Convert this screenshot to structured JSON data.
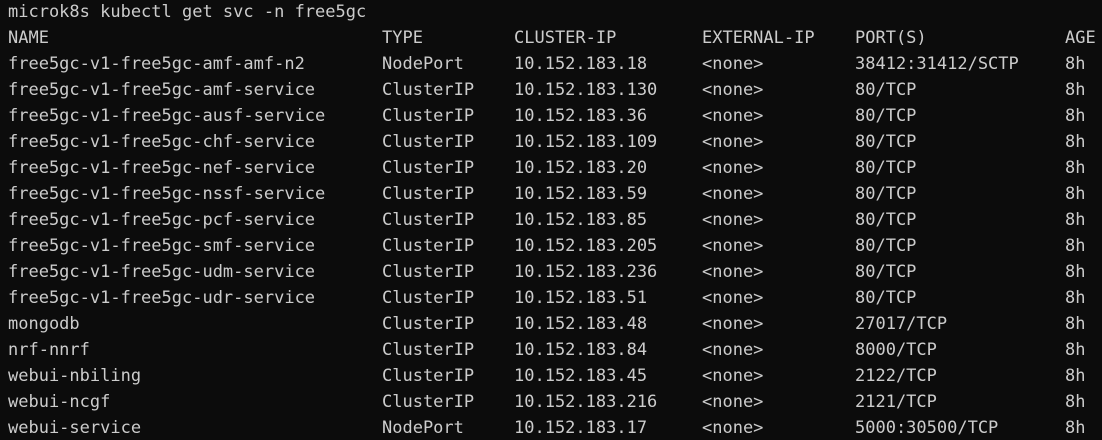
{
  "terminal": {
    "command": "microk8s kubectl get svc -n free5gc",
    "headers": {
      "name": "NAME",
      "type": "TYPE",
      "cluster_ip": "CLUSTER-IP",
      "external_ip": "EXTERNAL-IP",
      "ports": "PORT(S)",
      "age": "AGE"
    },
    "rows": [
      {
        "name": "free5gc-v1-free5gc-amf-amf-n2",
        "type": "NodePort",
        "cluster_ip": "10.152.183.18",
        "external_ip": "<none>",
        "ports": "38412:31412/SCTP",
        "age": "8h"
      },
      {
        "name": "free5gc-v1-free5gc-amf-service",
        "type": "ClusterIP",
        "cluster_ip": "10.152.183.130",
        "external_ip": "<none>",
        "ports": "80/TCP",
        "age": "8h"
      },
      {
        "name": "free5gc-v1-free5gc-ausf-service",
        "type": "ClusterIP",
        "cluster_ip": "10.152.183.36",
        "external_ip": "<none>",
        "ports": "80/TCP",
        "age": "8h"
      },
      {
        "name": "free5gc-v1-free5gc-chf-service",
        "type": "ClusterIP",
        "cluster_ip": "10.152.183.109",
        "external_ip": "<none>",
        "ports": "80/TCP",
        "age": "8h"
      },
      {
        "name": "free5gc-v1-free5gc-nef-service",
        "type": "ClusterIP",
        "cluster_ip": "10.152.183.20",
        "external_ip": "<none>",
        "ports": "80/TCP",
        "age": "8h"
      },
      {
        "name": "free5gc-v1-free5gc-nssf-service",
        "type": "ClusterIP",
        "cluster_ip": "10.152.183.59",
        "external_ip": "<none>",
        "ports": "80/TCP",
        "age": "8h"
      },
      {
        "name": "free5gc-v1-free5gc-pcf-service",
        "type": "ClusterIP",
        "cluster_ip": "10.152.183.85",
        "external_ip": "<none>",
        "ports": "80/TCP",
        "age": "8h"
      },
      {
        "name": "free5gc-v1-free5gc-smf-service",
        "type": "ClusterIP",
        "cluster_ip": "10.152.183.205",
        "external_ip": "<none>",
        "ports": "80/TCP",
        "age": "8h"
      },
      {
        "name": "free5gc-v1-free5gc-udm-service",
        "type": "ClusterIP",
        "cluster_ip": "10.152.183.236",
        "external_ip": "<none>",
        "ports": "80/TCP",
        "age": "8h"
      },
      {
        "name": "free5gc-v1-free5gc-udr-service",
        "type": "ClusterIP",
        "cluster_ip": "10.152.183.51",
        "external_ip": "<none>",
        "ports": "80/TCP",
        "age": "8h"
      },
      {
        "name": "mongodb",
        "type": "ClusterIP",
        "cluster_ip": "10.152.183.48",
        "external_ip": "<none>",
        "ports": "27017/TCP",
        "age": "8h"
      },
      {
        "name": "nrf-nnrf",
        "type": "ClusterIP",
        "cluster_ip": "10.152.183.84",
        "external_ip": "<none>",
        "ports": "8000/TCP",
        "age": "8h"
      },
      {
        "name": "webui-nbiling",
        "type": "ClusterIP",
        "cluster_ip": "10.152.183.45",
        "external_ip": "<none>",
        "ports": "2122/TCP",
        "age": "8h"
      },
      {
        "name": "webui-ncgf",
        "type": "ClusterIP",
        "cluster_ip": "10.152.183.216",
        "external_ip": "<none>",
        "ports": "2121/TCP",
        "age": "8h"
      },
      {
        "name": "webui-service",
        "type": "NodePort",
        "cluster_ip": "10.152.183.17",
        "external_ip": "<none>",
        "ports": "5000:30500/TCP",
        "age": "8h"
      }
    ]
  }
}
